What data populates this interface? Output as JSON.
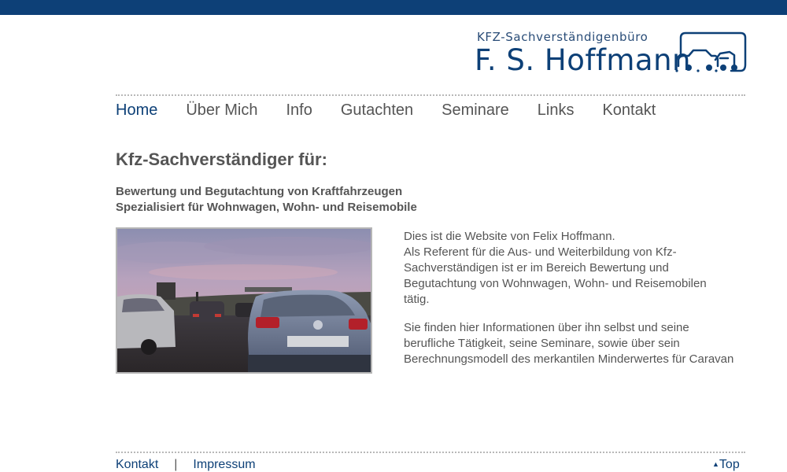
{
  "header": {
    "logo_subtitle": "KFZ-Sachverständigenbüro",
    "logo_title": "F. S. Hoffmann",
    "logo_icon": "caravan-car-icon",
    "brand_color": "#0d4077"
  },
  "nav": {
    "items": [
      "Home",
      "Über Mich",
      "Info",
      "Gutachten",
      "Seminare",
      "Links",
      "Kontakt"
    ],
    "active": "Home"
  },
  "main": {
    "title": "Kfz-Sachverständiger für:",
    "subheading_1": "Bewertung und Begutachtung von Kraftfahrzeugen",
    "subheading_2": "Spezialisiert für Wohnwagen, Wohn- und Reisemobile",
    "image_description": "traffic-jam-photo",
    "paragraph_1_line_1": "Dies ist die Website von Felix Hoffmann.",
    "paragraph_1_line_2": "Als Referent für die Aus- und Weiterbildung von Kfz-Sachverständigen ist er im Bereich Bewertung und Begutachtung von Wohnwagen, Wohn- und Reisemobilen tätig.",
    "paragraph_2": "Sie finden hier Informationen über ihn selbst und seine berufliche Tätigkeit, seine Seminare, sowie über sein Berechnungsmodell des merkantilen Minderwertes für Caravan"
  },
  "footer": {
    "kontakt": "Kontakt",
    "separator": "|",
    "impressum": "Impressum",
    "top": "Top",
    "top_icon": "triangle-up-icon"
  }
}
